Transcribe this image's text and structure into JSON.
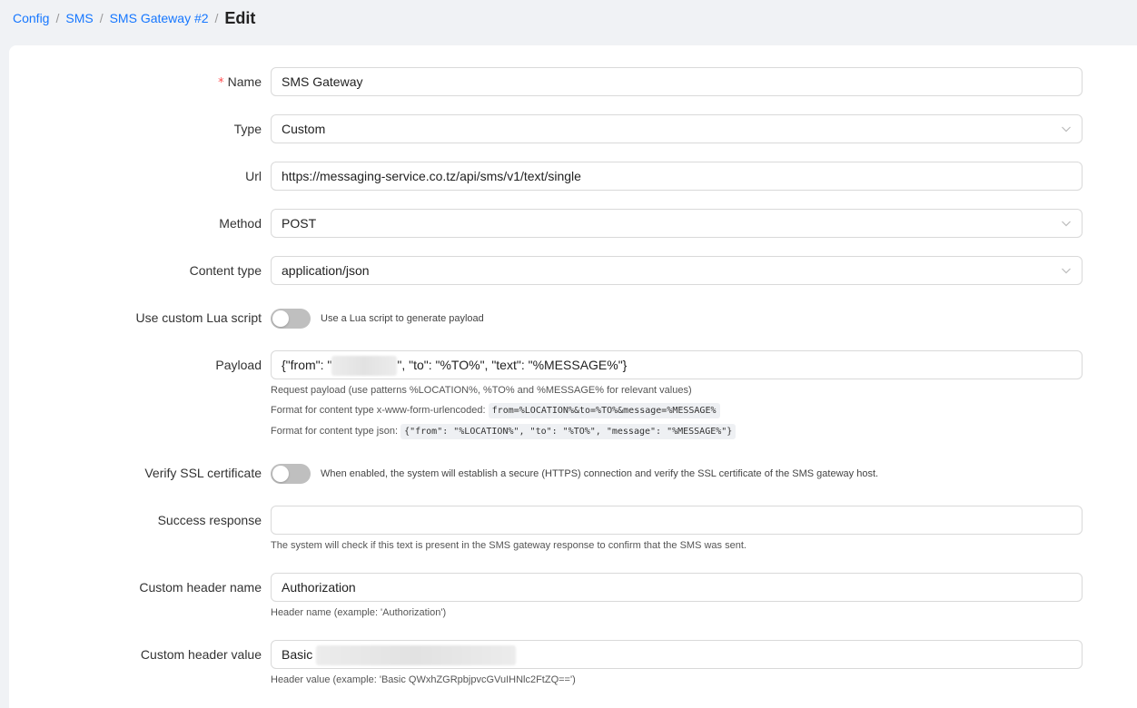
{
  "breadcrumb": {
    "items": [
      "Config",
      "SMS",
      "SMS Gateway #2"
    ],
    "separator": "/",
    "current": "Edit"
  },
  "form": {
    "name": {
      "label": "Name",
      "required_mark": "*",
      "value": "SMS Gateway"
    },
    "type": {
      "label": "Type",
      "value": "Custom"
    },
    "url": {
      "label": "Url",
      "value": "https://messaging-service.co.tz/api/sms/v1/text/single"
    },
    "method": {
      "label": "Method",
      "value": "POST"
    },
    "content_type": {
      "label": "Content type",
      "value": "application/json"
    },
    "lua": {
      "label": "Use custom Lua script",
      "enabled": false,
      "description": "Use a Lua script to generate payload"
    },
    "payload": {
      "label": "Payload",
      "value_prefix": "{\"from\": \"",
      "value_suffix": "\", \"to\": \"%TO%\", \"text\": \"%MESSAGE%\"}",
      "help_1": "Request payload (use patterns %LOCATION%, %TO% and %MESSAGE% for relevant values)",
      "help_2_label": "Format for content type x-www-form-urlencoded:",
      "help_2_code": "from=%LOCATION%&to=%TO%&message=%MESSAGE%",
      "help_3_label": "Format for content type json:",
      "help_3_code": "{\"from\": \"%LOCATION%\", \"to\": \"%TO%\", \"message\": \"%MESSAGE%\"}"
    },
    "ssl": {
      "label": "Verify SSL certificate",
      "enabled": false,
      "description": "When enabled, the system will establish a secure (HTTPS) connection and verify the SSL certificate of the SMS gateway host."
    },
    "success": {
      "label": "Success response",
      "value": "",
      "help": "The system will check if this text is present in the SMS gateway response to confirm that the SMS was sent."
    },
    "header_name": {
      "label": "Custom header name",
      "value": "Authorization",
      "help": "Header name (example: 'Authorization')"
    },
    "header_value": {
      "label": "Custom header value",
      "value_prefix": "Basic",
      "help": "Header value (example: 'Basic QWxhZGRpbjpvcGVuIHNlc2FtZQ==')"
    }
  },
  "colors": {
    "link": "#1677ff",
    "required": "#ff4d4f",
    "switch_off": "#bfbfbf",
    "border": "#d9d9d9"
  },
  "icons": {
    "select_arrow": "chevron-down-icon"
  }
}
